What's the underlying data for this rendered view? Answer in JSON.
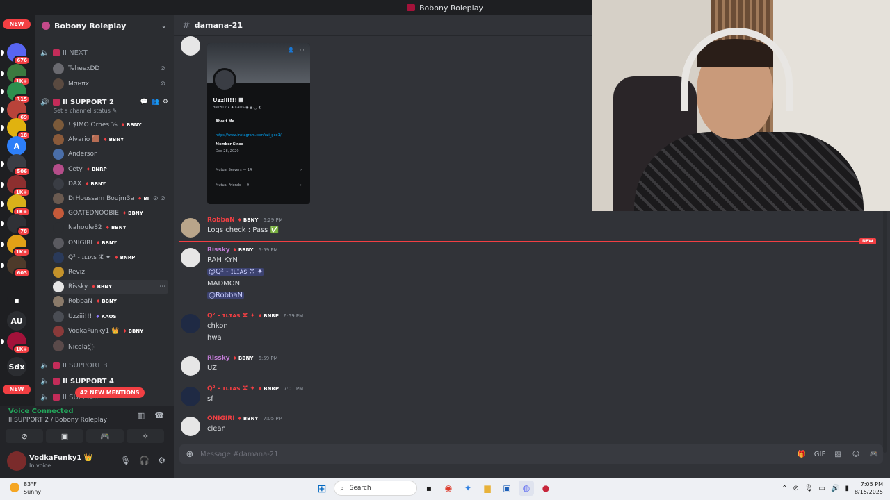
{
  "window": {
    "title": "Bobony Roleplay"
  },
  "rail": {
    "items": [
      {
        "label": "NEW",
        "kind": "new"
      },
      {
        "badge": "676",
        "color": "#5865f2"
      },
      {
        "badge": "1K+",
        "color": "#3b7a3f"
      },
      {
        "badge": "115",
        "color": "#2d8f4e"
      },
      {
        "badge": "69",
        "color": "#b8433a"
      },
      {
        "badge": "18",
        "color": "#e0b20f"
      },
      {
        "label": "A",
        "color": "#2d7ff9"
      },
      {
        "badge": "506",
        "color": "#3a3d44"
      },
      {
        "badge": "1K+",
        "color": "#8d2f2f"
      },
      {
        "badge": "1K+",
        "color": "#d9b11a"
      },
      {
        "badge": "78",
        "color": "#2f3136"
      },
      {
        "badge": "1K+",
        "color": "#e2a017"
      },
      {
        "badge": "603",
        "color": "#4d3a2a"
      },
      {
        "label": "▪",
        "color": "#1e1f22"
      },
      {
        "label": "AU",
        "color": "#2b2d31"
      },
      {
        "badge": "1K+",
        "color": "#a3123a"
      },
      {
        "label": "Sdx",
        "color": "#2b2d31"
      },
      {
        "label": "NEW",
        "kind": "new"
      }
    ]
  },
  "sidebar": {
    "server_name": "Bobony Roleplay",
    "channels": [
      {
        "name": "NEXT",
        "prefix": "II"
      },
      {
        "name": "SUPPORT 2",
        "prefix": "II"
      },
      {
        "name": "SUPPORT 3",
        "prefix": "II"
      },
      {
        "name": "SUPPORT 4",
        "prefix": "II"
      },
      {
        "name": "SUPPO...",
        "prefix": "II"
      }
    ],
    "status_line": "Set a channel status ✎",
    "next_users": [
      "TeheexDD",
      "Mσнπx"
    ],
    "support_users": [
      {
        "name": "! $IMO Ornes ⅝",
        "tag": "BBNY",
        "color": "#7b5a3a"
      },
      {
        "name": "Alvario 🟫",
        "tag": "BBNY",
        "color": "#8a5a3a"
      },
      {
        "name": "Anderson",
        "tag": "",
        "color": "#4a6ea8"
      },
      {
        "name": "Cety",
        "tag": "BNRP",
        "color": "#b54d8a"
      },
      {
        "name": "DAX",
        "tag": "BBNY",
        "color": "#3a3d44"
      },
      {
        "name": "DrHoussam Boujm3a",
        "tag": "BI",
        "color": "#6a5a50"
      },
      {
        "name": "GOATEDNOOBIE",
        "tag": "BBNY",
        "color": "#c45a3a"
      },
      {
        "name": "Nahoule82",
        "tag": "BBNY",
        "color": "#2b2d31"
      },
      {
        "name": "ONIGIRI",
        "tag": "BBNY",
        "color": "#5a5a60"
      },
      {
        "name": "Q² - ɪʟɪᴀs ⵣ ✦",
        "tag": "BNRP",
        "color": "#2a3a5a"
      },
      {
        "name": "Reviz",
        "tag": "",
        "color": "#c4922a"
      },
      {
        "name": "Rissky",
        "tag": "BBNY",
        "color": "#e6e6e6"
      },
      {
        "name": "RobbaN",
        "tag": "BBNY",
        "color": "#8a7a6a"
      },
      {
        "name": "Uzziii!!!",
        "tag": "KAOS",
        "color": "#4a4d54"
      },
      {
        "name": "VodkaFunky1 👑",
        "tag": "BBNY",
        "color": "#8a3a3a"
      },
      {
        "name": "Nicolas꙰",
        "tag": "",
        "color": "#5a4a4a"
      }
    ],
    "mentions": "42 NEW MENTIONS"
  },
  "voice": {
    "title": "Voice Connected",
    "channel": "II SUPPORT 2 / Bobony Roleplay"
  },
  "user_panel": {
    "name": "VodkaFunky1 👑",
    "status": "In voice"
  },
  "chat": {
    "channel": "damana-21",
    "profile_card": {
      "name": "Uzziii!!! 𝄜",
      "handle": "dauzi12 • ♦ KAOS ◉ ▲ ◯ ◐",
      "about_title": "About Me",
      "about_link": "https://www.instagram.com/uzi_gee1/",
      "member_title": "Member Since",
      "member_date": "Dec 28, 2020",
      "mutual_servers": "Mutual Servers — 14",
      "mutual_friends": "Mutual Friends — 9"
    },
    "messages": [
      {
        "author": "RobbaN",
        "color": "#f23f43",
        "tag": "BBNY",
        "time": "6:29 PM",
        "lines": [
          "Logs check : Pass ✅"
        ]
      },
      {
        "author": "Rissky",
        "color": "#c27cd6",
        "tag": "BBNY",
        "time": "6:59 PM",
        "lines": [
          "RAH KYN",
          "@Q² - ɪʟɪᴀs ⵣ ✦",
          "MADMON",
          "@RobbaN"
        ]
      },
      {
        "author": "Q² - ɪʟɪᴀs ⵣ ✦",
        "color": "#f23f43",
        "tag": "BNRP",
        "time": "6:59 PM",
        "lines": [
          "chkon",
          "hwa"
        ]
      },
      {
        "author": "Rissky",
        "color": "#c27cd6",
        "tag": "BBNY",
        "time": "6:59 PM",
        "lines": [
          "UZII"
        ]
      },
      {
        "author": "Q² - ɪʟɪᴀs ⵣ ✦",
        "color": "#f23f43",
        "tag": "BNRP",
        "time": "7:01 PM",
        "lines": [
          "sf"
        ]
      },
      {
        "author": "ONIGIRI",
        "color": "#f23f43",
        "tag": "BBNY",
        "time": "7:05 PM",
        "lines": [
          "clean"
        ]
      }
    ],
    "new_label": "NEW",
    "composer_placeholder": "Message #damana-21"
  },
  "taskbar": {
    "temp": "83°F",
    "weather": "Sunny",
    "search": "Search",
    "time": "7:05 PM",
    "date": "8/15/2025"
  }
}
